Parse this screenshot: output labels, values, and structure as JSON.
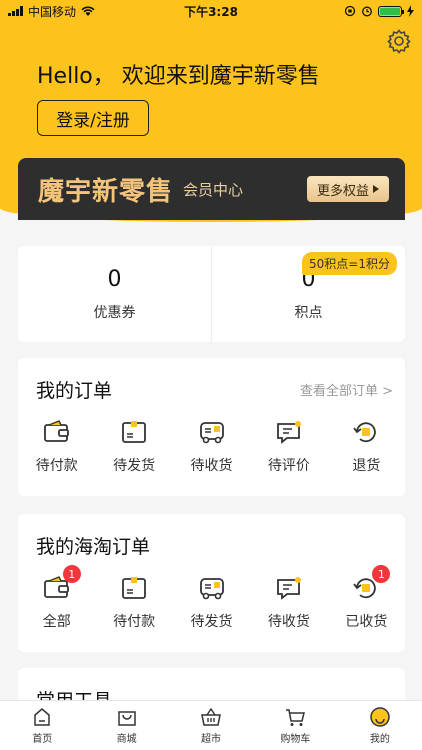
{
  "status": {
    "carrier": "中国移动",
    "time": "下午3:28"
  },
  "header": {
    "greeting": "Hello， 欢迎来到魔宇新零售",
    "login_label": "登录/注册"
  },
  "banner": {
    "title": "魔宇新零售",
    "subtitle": "会员中心",
    "button_label": "更多权益"
  },
  "points": {
    "badge": "50积点=1积分",
    "items": [
      {
        "value": "0",
        "label": "优惠券"
      },
      {
        "value": "0",
        "label": "积点"
      }
    ]
  },
  "orders": {
    "title": "我的订单",
    "link": "查看全部订单 >",
    "items": [
      {
        "label": "待付款",
        "icon": "wallet-icon"
      },
      {
        "label": "待发货",
        "icon": "package-icon"
      },
      {
        "label": "待收货",
        "icon": "truck-icon"
      },
      {
        "label": "待评价",
        "icon": "comment-icon"
      },
      {
        "label": "退货",
        "icon": "return-icon"
      }
    ]
  },
  "haitao": {
    "title": "我的海淘订单",
    "items": [
      {
        "label": "全部",
        "icon": "wallet-icon",
        "badge": "1"
      },
      {
        "label": "待付款",
        "icon": "package-icon"
      },
      {
        "label": "待发货",
        "icon": "truck-icon"
      },
      {
        "label": "待收货",
        "icon": "comment-icon"
      },
      {
        "label": "已收货",
        "icon": "return-icon",
        "badge": "1"
      }
    ]
  },
  "tools": {
    "title": "常用工具"
  },
  "tabbar": [
    {
      "label": "首页",
      "icon": "home-icon"
    },
    {
      "label": "商城",
      "icon": "shop-bag-icon"
    },
    {
      "label": "超市",
      "icon": "basket-icon"
    },
    {
      "label": "购物车",
      "icon": "cart-icon"
    },
    {
      "label": "我的",
      "icon": "profile-icon",
      "active": true
    }
  ],
  "colors": {
    "accent": "#fcc31c",
    "badge": "#f2373a",
    "banner": "#2e2e2e"
  }
}
